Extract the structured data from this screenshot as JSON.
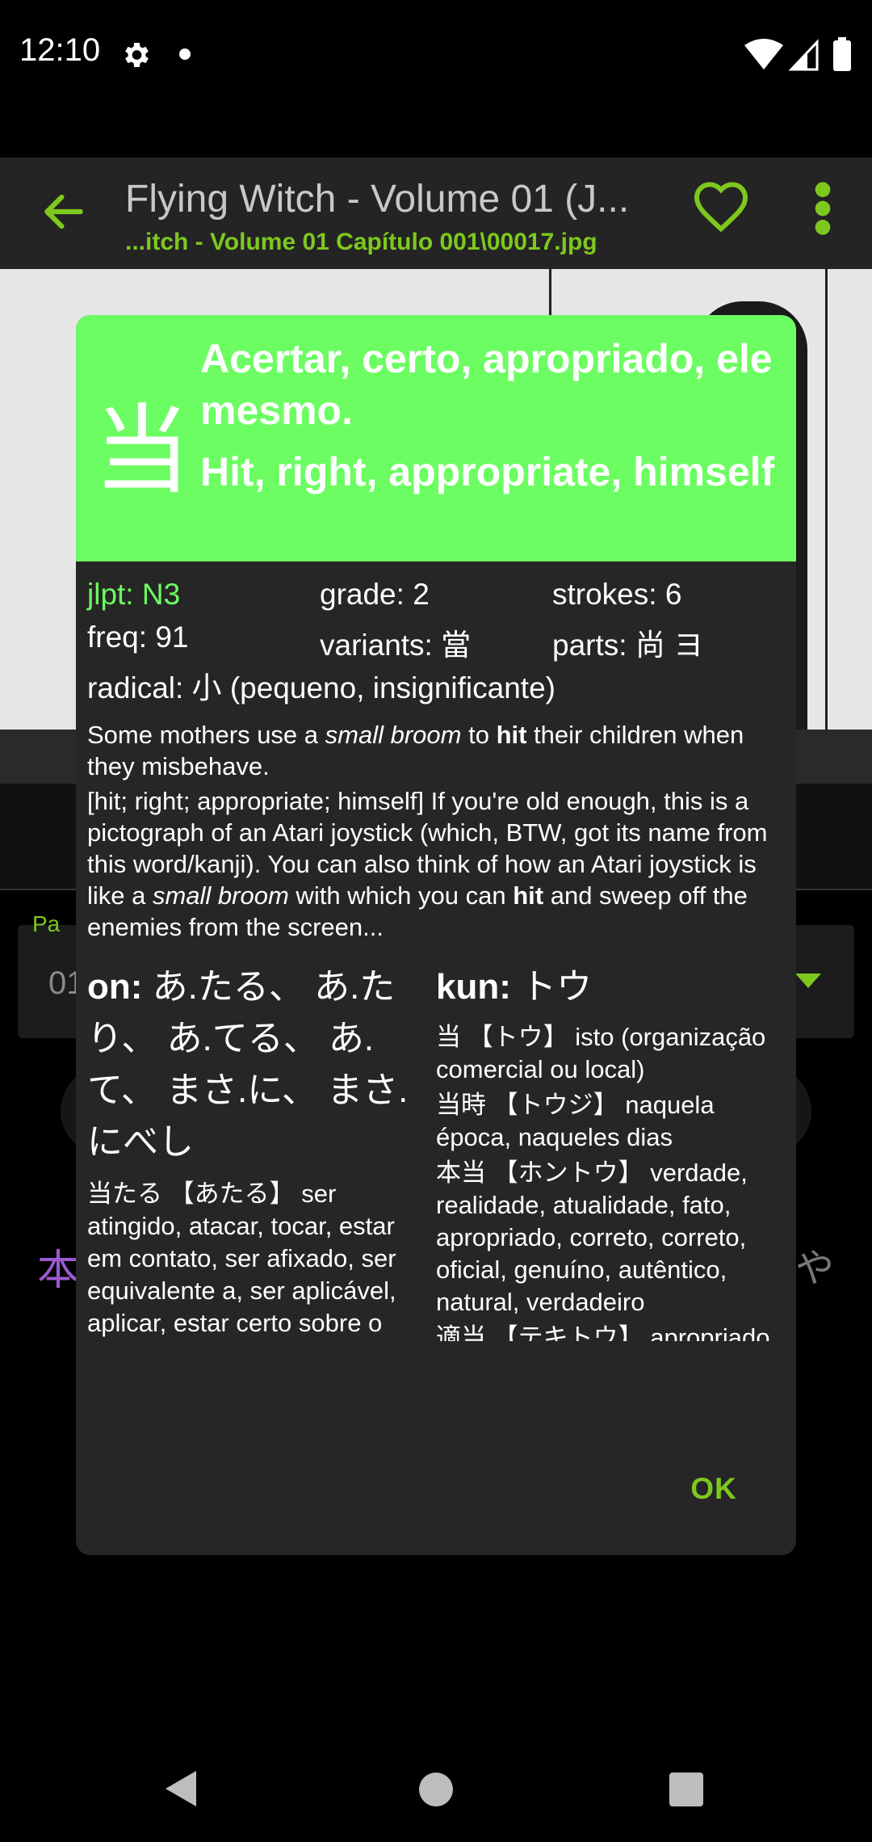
{
  "status_bar": {
    "time": "12:10",
    "icons": [
      "gear-icon",
      "dot-icon",
      "wifi-icon",
      "signal-icon",
      "battery-icon"
    ]
  },
  "app_bar": {
    "title": "Flying Witch - Volume 01 (J...",
    "subtitle": "...itch - Volume 01 Capítulo 001\\00017.jpg",
    "accent_color": "#7dc81e"
  },
  "background": {
    "field_label": "Pa",
    "field_value": "01",
    "hon_char": "本",
    "ya_char": "や"
  },
  "dialog": {
    "kanji": "当",
    "meaning_pt": "Acertar, certo, apropriado, ele mesmo.",
    "meaning_en": "Hit, right, appropriate, himself",
    "header_color": "#6cfd62",
    "info": {
      "jlpt": "jlpt: N3",
      "grade": "grade: 2",
      "strokes": "strokes: 6",
      "freq": "freq: 91",
      "variants": "variants: 當",
      "parts": "parts: 尚 ヨ",
      "radical": "radical: 小 (pequeno, insignificante)"
    },
    "mnemonic": {
      "line1_a": "Some mothers use a ",
      "line1_b": "small broom",
      "line1_c": " to ",
      "line1_d": "hit",
      "line1_e": " their children when they misbehave.",
      "line2_a": "[hit; right; appropriate; himself] If you're old enough, this is a pictograph of an Atari joystick (which, BTW, got its name from this word/kanji). You can also think of how an Atari joystick is like a ",
      "line2_b": "small broom",
      "line2_c": " with which you can ",
      "line2_d": "hit",
      "line2_e": " and sweep off the enemies from the screen..."
    },
    "on": {
      "label": "on:",
      "readings": " あ.たる、 あ.たり、 あ.てる、 あ.て、 まさ.に、 まさ.にべし",
      "vocab": [
        "当たる 【あたる】 ser atingido, atacar, tocar, estar em contato, ser afixado, ser equivalente a, ser aplicável, aplicar, estar certo sobre o dinheiro (de uma previsão, crítica, etc.), ser selecionado (em uma"
      ]
    },
    "kun": {
      "label": "kun:",
      "readings": " トウ",
      "vocab": [
        "当 【トウ】 isto (organização comercial ou local)",
        "当時 【トウジ】 naquela época, naqueles dias",
        "本当 【ホントウ】 verdade, realidade, atualidade, fato, apropriado, correto, correto, oficial, genuíno, autêntico, natural, verdadeiro",
        "適当 【テキトウ】 apropriado, apropriado,"
      ]
    },
    "ok_label": "OK"
  },
  "nav_bar": {
    "icons": [
      "back-triangle-icon",
      "home-circle-icon",
      "recents-square-icon"
    ]
  }
}
